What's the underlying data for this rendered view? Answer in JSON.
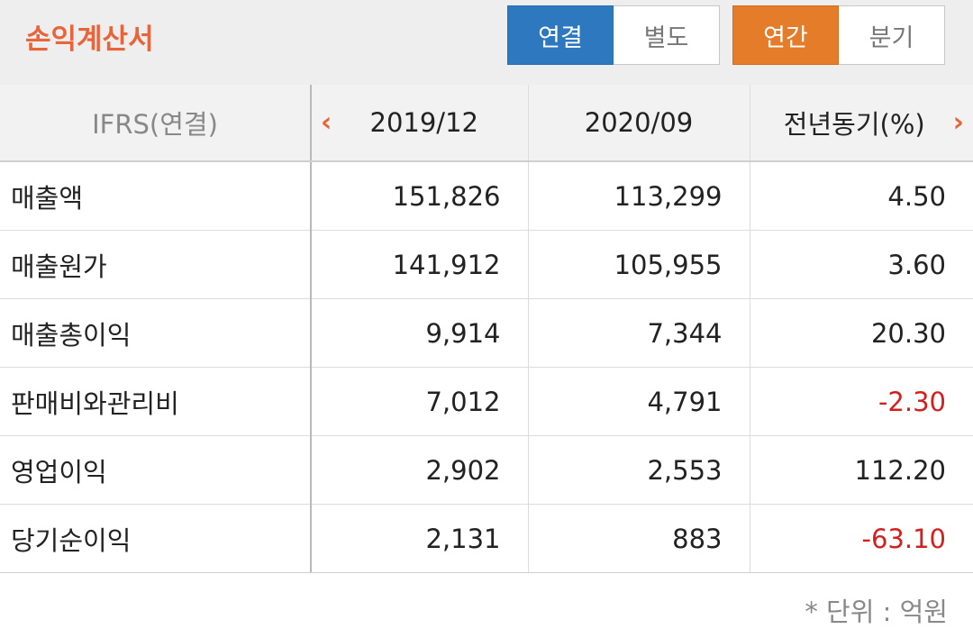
{
  "header": {
    "title": "손익계산서",
    "consolidation_toggle": {
      "options": [
        "연결",
        "별도"
      ],
      "selected": "연결"
    },
    "period_toggle": {
      "options": [
        "연간",
        "분기"
      ],
      "selected": "연간"
    }
  },
  "table": {
    "columns": [
      "IFRS(연결)",
      "2019/12",
      "2020/09",
      "전년동기(%)"
    ],
    "nav": {
      "prev_icon": "chevron-left-icon",
      "next_icon": "chevron-right-icon"
    },
    "rows": [
      {
        "label": "매출액",
        "values": [
          "151,826",
          "113,299",
          "4.50"
        ]
      },
      {
        "label": "매출원가",
        "values": [
          "141,912",
          "105,955",
          "3.60"
        ]
      },
      {
        "label": "매출총이익",
        "values": [
          "9,914",
          "7,344",
          "20.30"
        ]
      },
      {
        "label": "판매비와관리비",
        "values": [
          "7,012",
          "4,791",
          "-2.30"
        ]
      },
      {
        "label": "영업이익",
        "values": [
          "2,902",
          "2,553",
          "112.20"
        ]
      },
      {
        "label": "당기순이익",
        "values": [
          "2,131",
          "883",
          "-63.10"
        ]
      }
    ]
  },
  "footer": {
    "unit_note": "* 단위 : 억원"
  },
  "colors": {
    "accent_orange": "#e8643a",
    "active_blue": "#2e78bf",
    "active_orange": "#e57c2a",
    "negative_red": "#d3201f"
  }
}
